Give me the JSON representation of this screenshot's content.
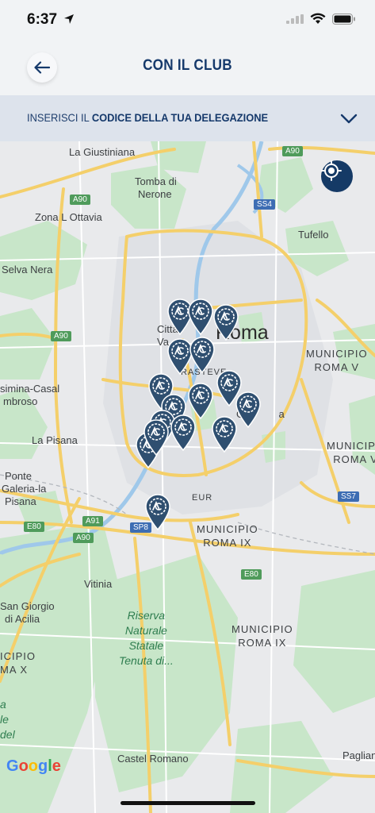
{
  "status": {
    "time": "6:37"
  },
  "header": {
    "title": "CON IL CLUB"
  },
  "code_bar": {
    "prefix": "INSERISCI IL ",
    "bold": "CODICE DELLA TUA DELEGAZIONE"
  },
  "map": {
    "labels": {
      "la_giustiniana": "La Giustiniana",
      "tomba_1": "Tomba di",
      "tomba_2": "Nerone",
      "zona_ottavia": "Zona L Ottavia",
      "tufello": "Tufello",
      "selva_nera": "Selva Nera",
      "roma": "Roma",
      "citta_1": "Citta",
      "citta_2": "Va",
      "trastevere": "RASTEVE",
      "muni_v_1": "MUNICIPIO",
      "muni_v_2": "ROMA V",
      "casal_1": "simina-Casal",
      "casal_2": "mbroso",
      "garbatella": "Ga          a",
      "la_pisana": "La Pisana",
      "muni_vii_1": "MUNICIPIO",
      "muni_vii_2": "ROMA VI",
      "ponte_1": "Ponte",
      "ponte_2": "Galeria-la",
      "ponte_3": "Pisana",
      "eur": "EUR",
      "muni_ix_1": "MUNICIPIO",
      "muni_ix_2": "ROMA IX",
      "vitinia": "Vitinia",
      "san_giorgio_1": "San Giorgio",
      "san_giorgio_2": "di Acilia",
      "muni_ix_b_1": "MUNICIPIO",
      "muni_ix_b_2": "ROMA IX",
      "riserva_1": "Riserva",
      "riserva_2": "Naturale",
      "riserva_3": "Statale",
      "riserva_4": "Tenuta di...",
      "muni_x_1": "ICIPIO",
      "muni_x_2": "MA X",
      "castel_romano": "Castel Romano",
      "pagliani": "Paglian",
      "side_1": "a",
      "side_2": "le",
      "side_3": "del"
    },
    "road_tags": {
      "a90_top": "A90",
      "ss4": "SS4",
      "a90_left": "A90",
      "a90_mid": "A90",
      "e80_left": "E80",
      "a91": "A91",
      "a90_bottom": "A90",
      "sp8": "SP8",
      "ss7": "SS7",
      "e80_right": "E80"
    },
    "attribution": "Google",
    "pin_count": 16
  },
  "colors": {
    "accent": "#15396b",
    "pin": "#2f4f70",
    "park": "#c5e8c9",
    "road_major": "#f7d77b"
  }
}
